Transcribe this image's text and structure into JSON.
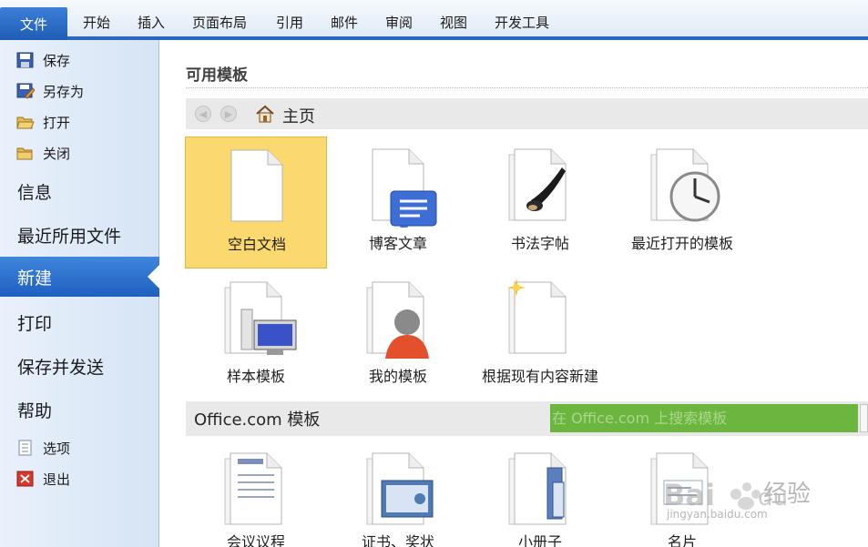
{
  "ribbon": {
    "file_tab": "文件",
    "tabs": [
      "开始",
      "插入",
      "页面布局",
      "引用",
      "邮件",
      "审阅",
      "视图",
      "开发工具"
    ]
  },
  "backstage": {
    "small_commands": [
      {
        "label": "保存",
        "icon": "save-icon"
      },
      {
        "label": "另存为",
        "icon": "save-as-icon"
      },
      {
        "label": "打开",
        "icon": "open-folder-icon"
      },
      {
        "label": "关闭",
        "icon": "close-folder-icon"
      }
    ],
    "items": [
      "信息",
      "最近所用文件",
      "新建",
      "打印",
      "保存并发送",
      "帮助"
    ],
    "selected": "新建",
    "bottom_commands": [
      {
        "label": "选项",
        "icon": "options-icon"
      },
      {
        "label": "退出",
        "icon": "exit-icon"
      }
    ]
  },
  "main": {
    "heading": "可用模板",
    "nav_location": "主页",
    "templates": [
      {
        "label": "空白文档",
        "icon": "blank-document-icon",
        "selected": true
      },
      {
        "label": "博客文章",
        "icon": "blog-post-icon"
      },
      {
        "label": "书法字帖",
        "icon": "calligraphy-icon"
      },
      {
        "label": "最近打开的模板",
        "icon": "recent-templates-icon"
      },
      {
        "label": "样本模板",
        "icon": "sample-templates-icon"
      },
      {
        "label": "我的模板",
        "icon": "my-templates-icon"
      },
      {
        "label": "根据现有内容新建",
        "icon": "new-from-existing-icon"
      }
    ],
    "office_section": {
      "title": "Office.com 模板",
      "search_placeholder": "在 Office.com 上搜索模板",
      "templates": [
        {
          "label": "会议议程",
          "icon": "agenda-icon"
        },
        {
          "label": "证书、奖状",
          "icon": "certificate-icon"
        },
        {
          "label": "小册子",
          "icon": "booklet-icon"
        },
        {
          "label": "名片",
          "icon": "business-card-icon"
        }
      ]
    }
  },
  "watermark": {
    "text": "经验",
    "url": "jingyan.baidu.com"
  },
  "colors": {
    "accent": "#1f5db6",
    "selected_template": "#fcd96e",
    "search_bar": "#6cb63f"
  }
}
